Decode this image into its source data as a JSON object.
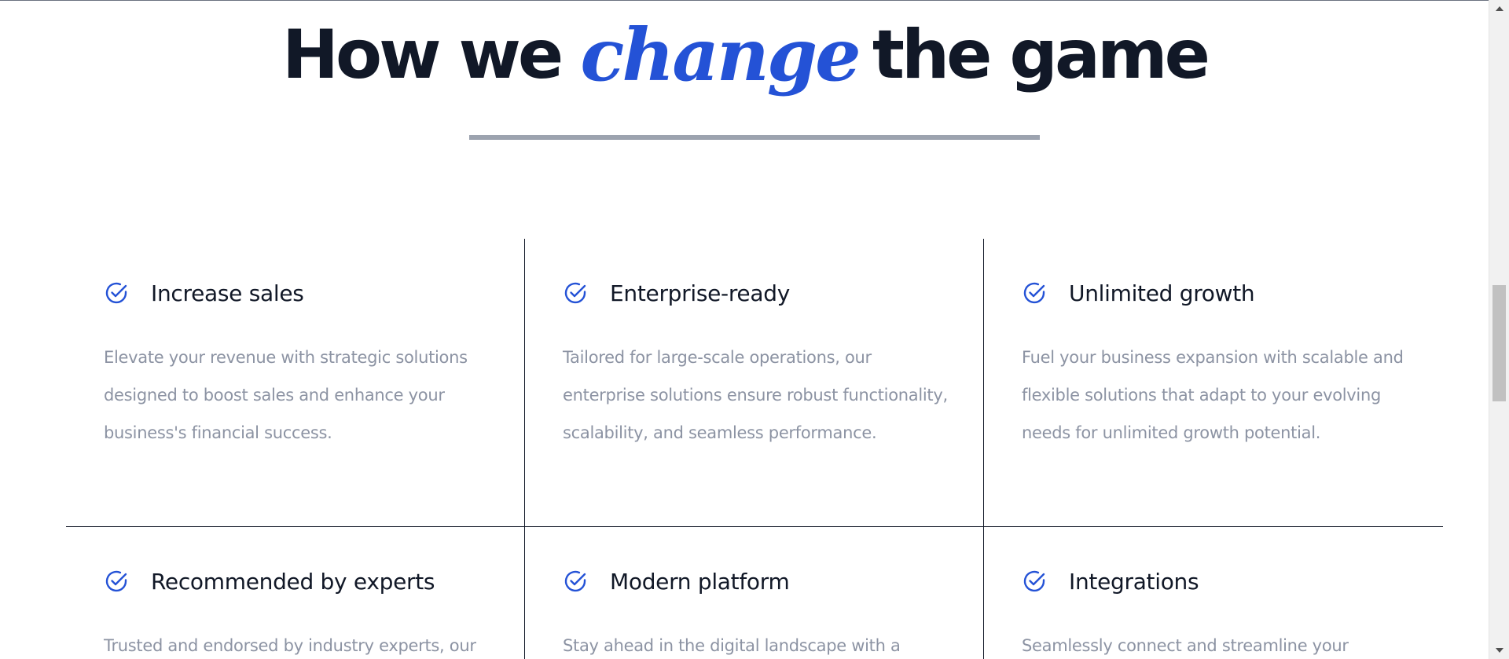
{
  "heading": {
    "before": "How we",
    "accent": "change",
    "after": "the game"
  },
  "colors": {
    "accent": "#2452d6",
    "heading": "#111827",
    "body_text": "#8c93a3",
    "divider": "#9ca3af"
  },
  "features": [
    {
      "icon": "check-circle-icon",
      "title": "Increase sales",
      "description": "Elevate your revenue with strategic solutions designed to boost sales and enhance your business's financial success."
    },
    {
      "icon": "check-circle-icon",
      "title": "Enterprise-ready",
      "description": "Tailored for large-scale operations, our enterprise solutions ensure robust functionality, scalability, and seamless performance."
    },
    {
      "icon": "check-circle-icon",
      "title": "Unlimited growth",
      "description": "Fuel your business expansion with scalable and flexible solutions that adapt to your evolving needs for unlimited growth potential."
    },
    {
      "icon": "check-circle-icon",
      "title": "Recommended by experts",
      "description": "Trusted and endorsed by industry experts, our"
    },
    {
      "icon": "check-circle-icon",
      "title": "Modern platform",
      "description": "Stay ahead in the digital landscape with a"
    },
    {
      "icon": "check-circle-icon",
      "title": "Integrations",
      "description": "Seamlessly connect and streamline your"
    }
  ]
}
